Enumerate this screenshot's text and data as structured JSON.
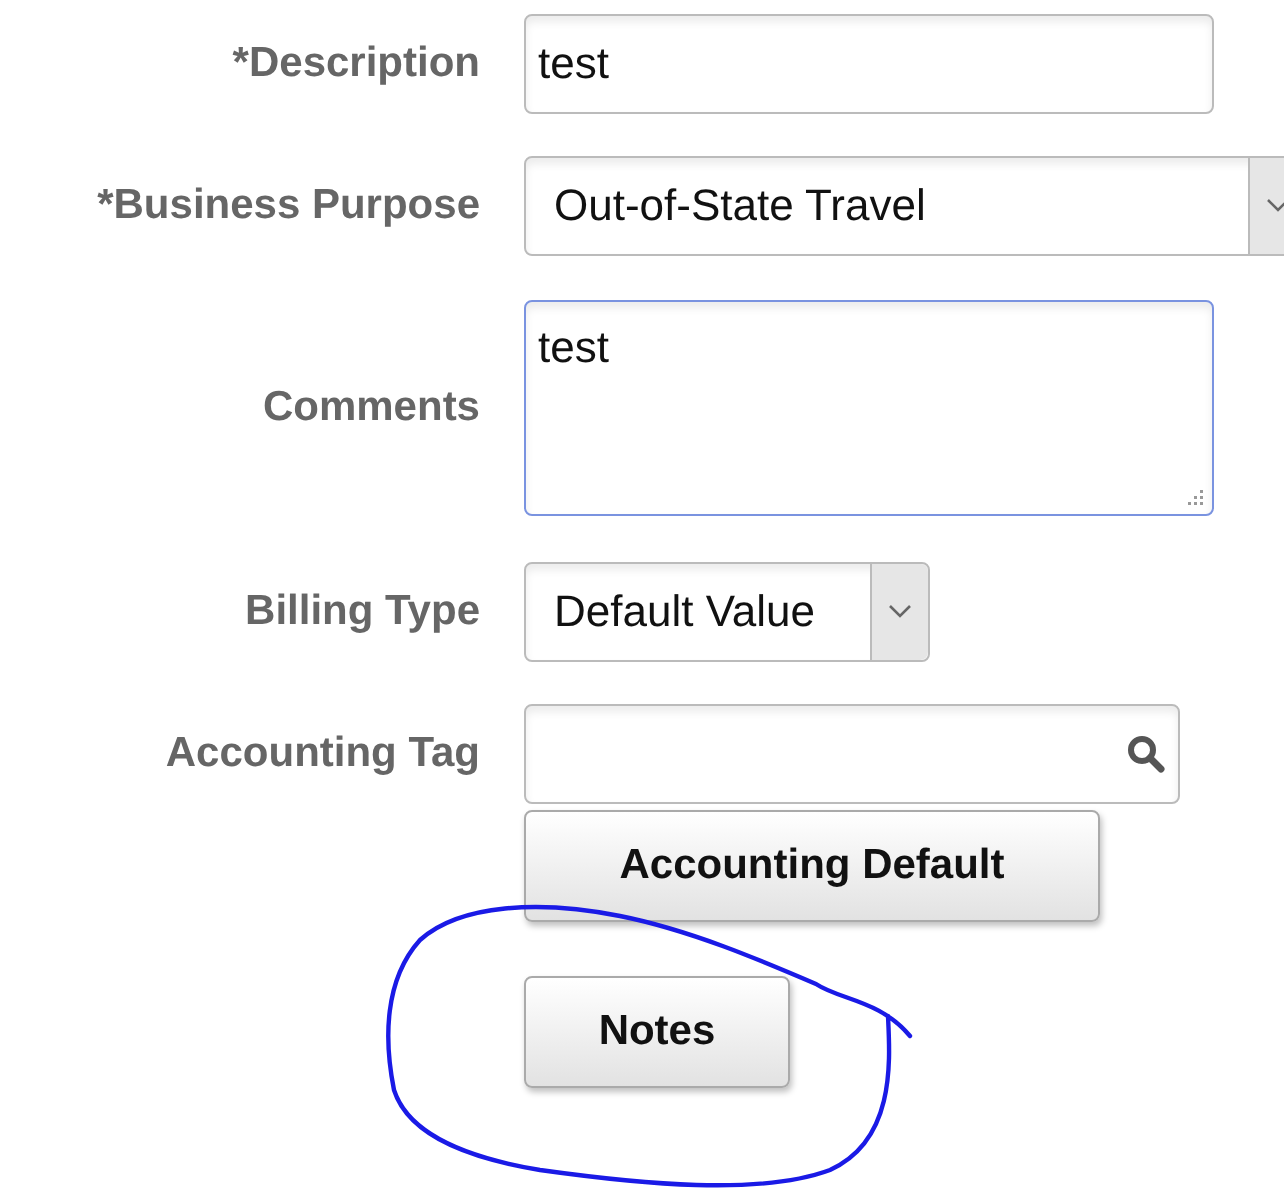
{
  "fields": [
    {
      "kind": "text",
      "label": "*Description",
      "value": "test"
    },
    {
      "kind": "select",
      "label": "*Business Purpose",
      "value": "Out-of-State Travel"
    },
    {
      "kind": "textarea",
      "label": "Comments",
      "value": "test",
      "focused": true
    },
    {
      "kind": "select",
      "label": "Billing Type",
      "value": "Default Value"
    },
    {
      "kind": "lookup",
      "label": "Accounting Tag"
    }
  ],
  "buttons": [
    {
      "label": "Accounting Default"
    },
    {
      "label": "Notes"
    }
  ]
}
